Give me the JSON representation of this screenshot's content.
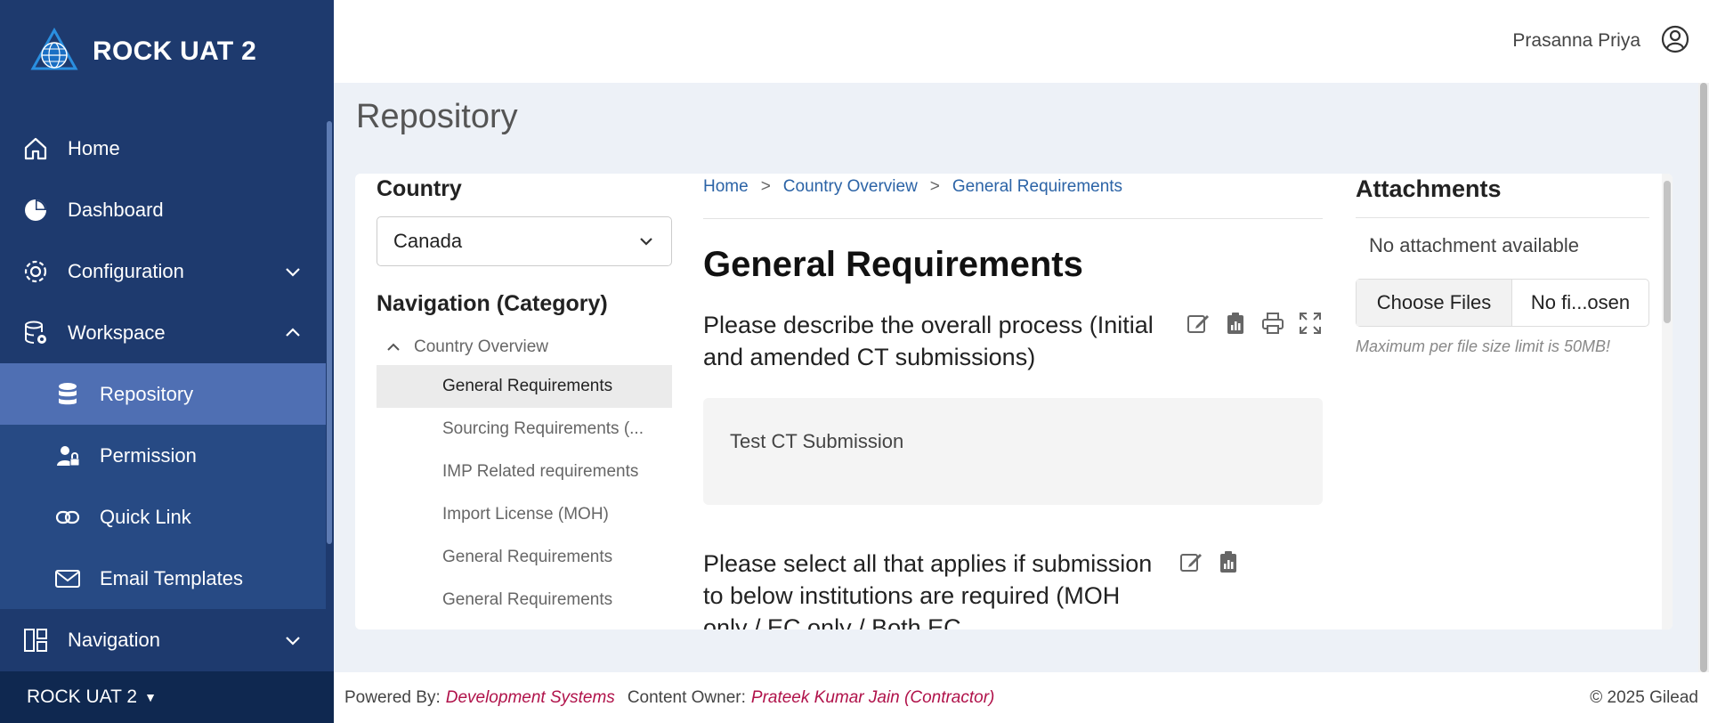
{
  "app": {
    "title": "ROCK UAT 2",
    "footer_env": "ROCK UAT 2"
  },
  "sidebar": {
    "items": [
      {
        "label": "Home",
        "icon": "home-icon"
      },
      {
        "label": "Dashboard",
        "icon": "pie-chart-icon"
      },
      {
        "label": "Configuration",
        "icon": "gear-icon"
      },
      {
        "label": "Workspace",
        "icon": "database-gear-icon"
      },
      {
        "label": "Navigation",
        "icon": "layout-icon"
      }
    ],
    "workspace_sub": [
      {
        "label": "Repository",
        "icon": "database-icon",
        "active": true
      },
      {
        "label": "Permission",
        "icon": "user-lock-icon"
      },
      {
        "label": "Quick Link",
        "icon": "link-icon"
      },
      {
        "label": "Email Templates",
        "icon": "envelope-icon"
      }
    ]
  },
  "user": {
    "name": "Prasanna Priya"
  },
  "page": {
    "title": "Repository"
  },
  "filters": {
    "country_label": "Country",
    "country_value": "Canada",
    "nav_label": "Navigation (Category)"
  },
  "tree": {
    "parent": "Country Overview",
    "children": [
      "General Requirements",
      "Sourcing Requirements (...",
      "IMP Related requirements",
      "Import License (MOH)",
      "General Requirements",
      "General Requirements"
    ]
  },
  "breadcrumb": {
    "home": "Home",
    "sep": ">",
    "overview": "Country Overview",
    "current": "General Requirements"
  },
  "content": {
    "section_title": "General Requirements",
    "q1": "Please describe the overall process (Initial and amended CT submissions)",
    "a1": "Test CT Submission",
    "q2": "Please select all that applies if submission to below institutions are required (MOH only / EC only / Both EC"
  },
  "attachments": {
    "title": "Attachments",
    "empty": "No attachment available",
    "choose": "Choose Files",
    "status": "No fi...osen",
    "hint": "Maximum per file size limit is 50MB!"
  },
  "footer": {
    "powered_label": "Powered By:",
    "powered_value": "Development Systems",
    "owner_label": "Content Owner:",
    "owner_value": "Prateek Kumar Jain (Contractor)",
    "copyright": "© 2025 Gilead"
  },
  "colors": {
    "sidebar": "#1e3a6e",
    "active": "#4f6fb3",
    "link": "#2b63a6",
    "accent": "#b0124a"
  }
}
